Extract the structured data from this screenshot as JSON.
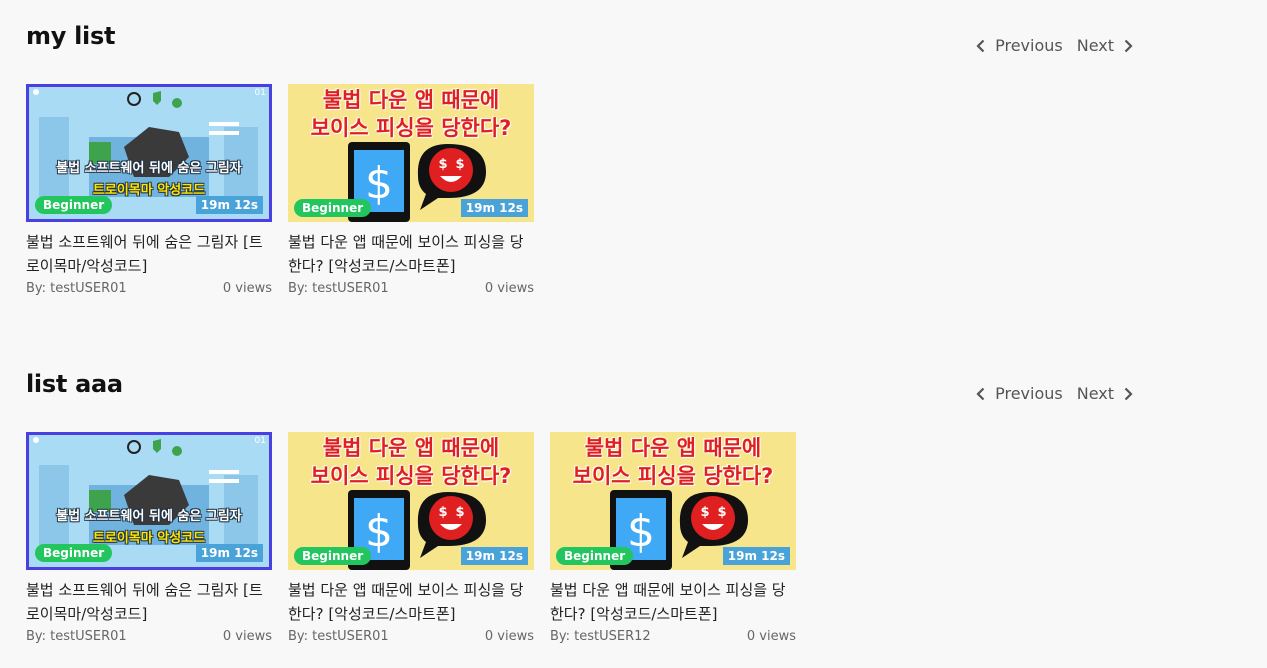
{
  "sections": [
    {
      "title": "my list",
      "pager": {
        "previous": "Previous",
        "next": "Next"
      },
      "cards": [
        {
          "thumb_type": "trojan",
          "thumb_text": [
            "불법 소프트웨어 뒤에 숨은 그림자",
            "트로이목마 악성코드"
          ],
          "level": "Beginner",
          "duration": "19m 12s",
          "title": "불법 소프트웨어 뒤에 숨은 그림자 [트로이목마/악성코드]",
          "author": "By: testUSER01",
          "views": "0 views"
        },
        {
          "thumb_type": "phish",
          "thumb_text": [
            "불법 다운 앱 때문에",
            "보이스 피싱을 당한다?"
          ],
          "level": "Beginner",
          "duration": "19m 12s",
          "title": "불법 다운 앱 때문에 보이스 피싱을 당한다? [악성코드/스마트폰]",
          "author": "By: testUSER01",
          "views": "0 views"
        }
      ]
    },
    {
      "title": "list aaa",
      "pager": {
        "previous": "Previous",
        "next": "Next"
      },
      "cards": [
        {
          "thumb_type": "trojan",
          "thumb_text": [
            "불법 소프트웨어 뒤에 숨은 그림자",
            "트로이목마 악성코드"
          ],
          "level": "Beginner",
          "duration": "19m 12s",
          "title": "불법 소프트웨어 뒤에 숨은 그림자 [트로이목마/악성코드]",
          "author": "By: testUSER01",
          "views": "0 views"
        },
        {
          "thumb_type": "phish",
          "thumb_text": [
            "불법 다운 앱 때문에",
            "보이스 피싱을 당한다?"
          ],
          "level": "Beginner",
          "duration": "19m 12s",
          "title": "불법 다운 앱 때문에 보이스 피싱을 당한다? [악성코드/스마트폰]",
          "author": "By: testUSER01",
          "views": "0 views"
        },
        {
          "thumb_type": "phish",
          "thumb_text": [
            "불법 다운 앱 때문에",
            "보이스 피싱을 당한다?"
          ],
          "level": "Beginner",
          "duration": "19m 12s",
          "title": "불법 다운 앱 때문에 보이스 피싱을 당한다? [악성코드/스마트폰]",
          "author": "By: testUSER12",
          "views": "0 views"
        }
      ]
    }
  ],
  "colors": {
    "level_badge": "#22c55e",
    "time_badge": "#4aa3d8",
    "trojan_border": "#4a3fe0",
    "phish_bg": "#f6e58b"
  },
  "icons": {
    "previous": "chevron-left-icon",
    "next": "chevron-right-icon"
  }
}
